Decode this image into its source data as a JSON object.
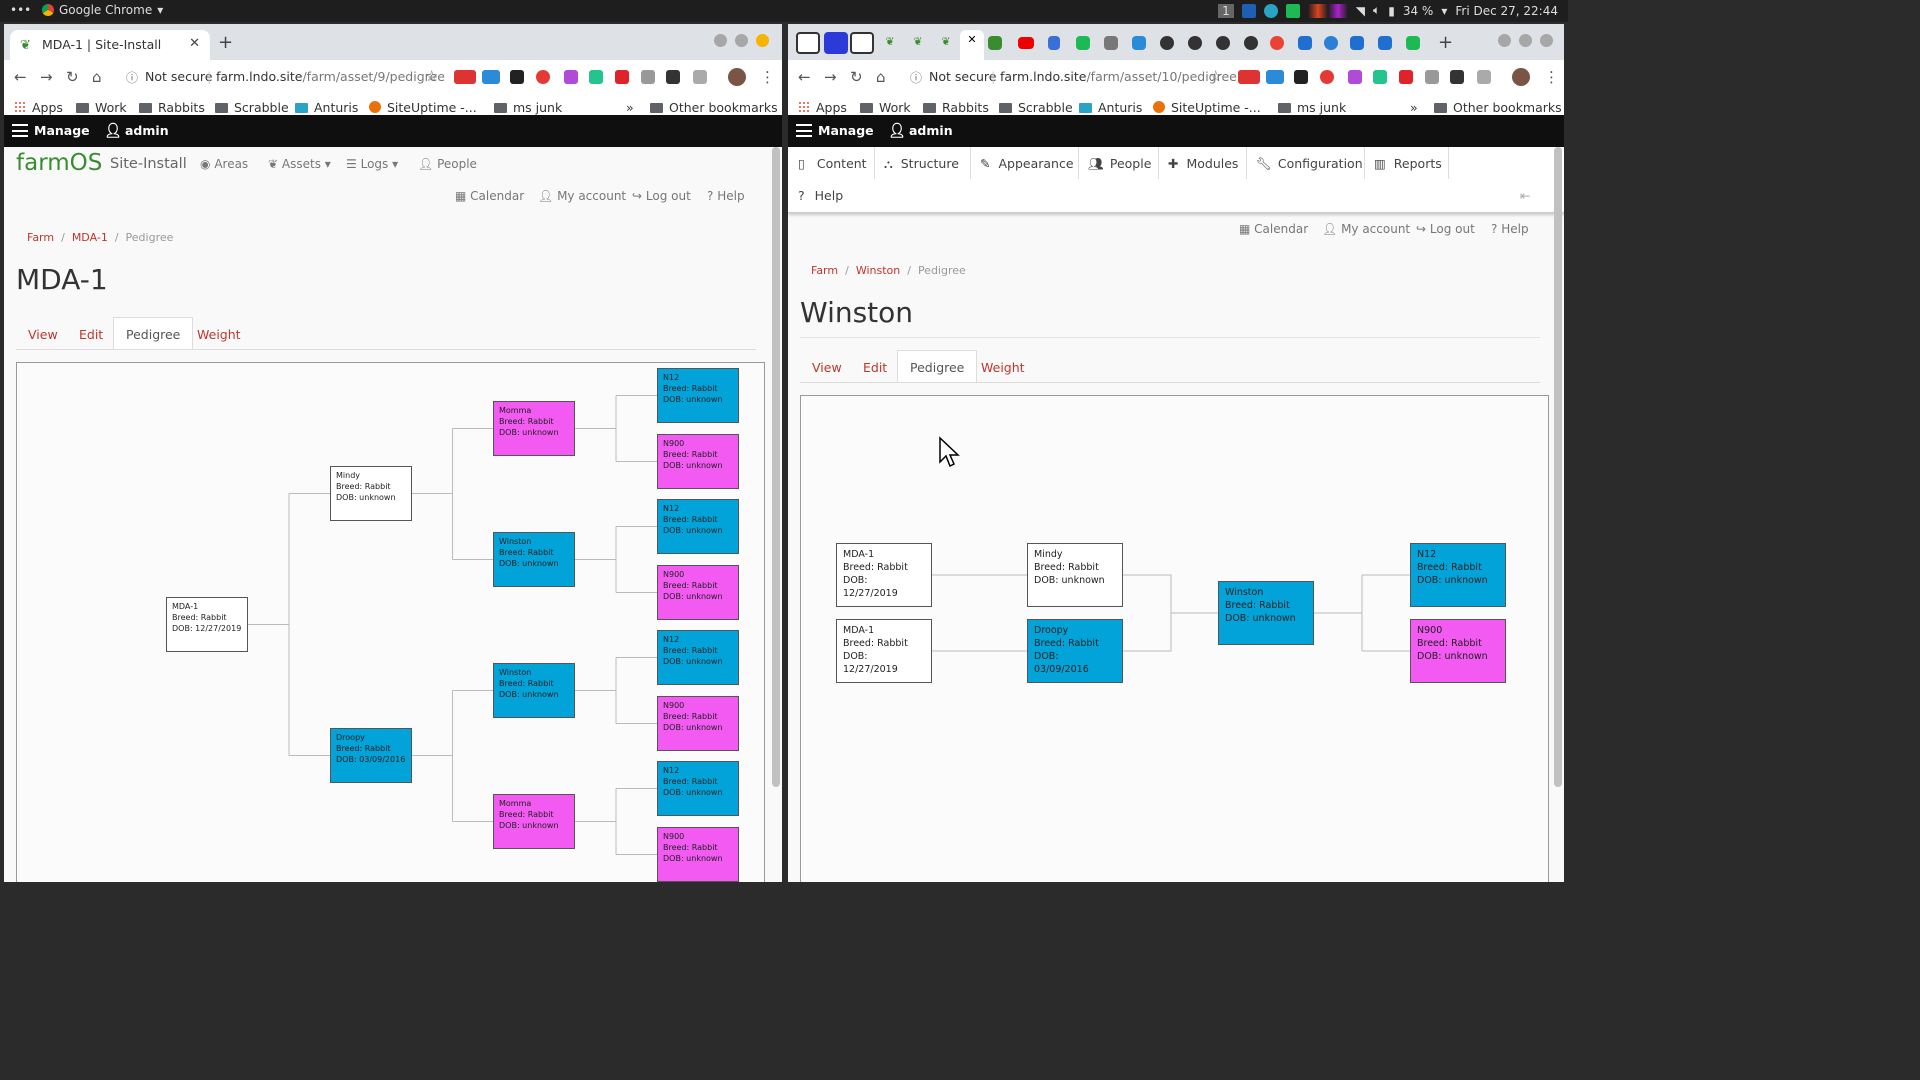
{
  "system_bar": {
    "menu_dots": "•••",
    "app_name": "Google Chrome",
    "workspace": "1",
    "battery": "34 %",
    "clock": "Fri Dec 27, 22:44"
  },
  "left_window": {
    "tab_title": "MDA-1 | Site-Install",
    "address": {
      "security": "Not secure",
      "host": "farm.lndo.site",
      "path": "/farm/asset/9/pedigree"
    },
    "toolbar": {
      "back": "←",
      "forward": "→",
      "reload": "↻",
      "home": "⌂",
      "star": "☆",
      "menu": "⋮"
    },
    "bookmarks": [
      "Apps",
      "Work",
      "Rabbits",
      "Scrabble",
      "Anturis",
      "SiteUptime -...",
      "ms junk"
    ],
    "bookmarks_more": "»",
    "other_bookmarks": "Other bookmarks",
    "admin_bar": {
      "manage": "Manage",
      "user": "admin"
    },
    "brand": "farmOS",
    "site_name": "Site-Install",
    "main_nav": [
      "Areas",
      "Assets",
      "Logs",
      "People"
    ],
    "secondary_nav": [
      "Calendar",
      "My account",
      "Log out",
      "Help"
    ],
    "breadcrumb": [
      "Farm",
      "MDA-1",
      "Pedigree"
    ],
    "page_title": "MDA-1",
    "tabs": [
      "View",
      "Edit",
      "Pedigree",
      "Weight"
    ],
    "pedigree": [
      {
        "name": "MDA-1",
        "breed": "Breed: Rabbit",
        "dob": "DOB: 12/27/2019",
        "color": "white"
      },
      {
        "name": "Mindy",
        "breed": "Breed: Rabbit",
        "dob": "DOB: unknown",
        "color": "white"
      },
      {
        "name": "Droopy",
        "breed": "Breed: Rabbit",
        "dob": "DOB: 03/09/2016",
        "color": "blue"
      },
      {
        "name": "Momma",
        "breed": "Breed: Rabbit",
        "dob": "DOB: unknown",
        "color": "pink"
      },
      {
        "name": "Winston",
        "breed": "Breed: Rabbit",
        "dob": "DOB: unknown",
        "color": "blue"
      },
      {
        "name": "Winston",
        "breed": "Breed: Rabbit",
        "dob": "DOB: unknown",
        "color": "blue"
      },
      {
        "name": "Momma",
        "breed": "Breed: Rabbit",
        "dob": "DOB: unknown",
        "color": "pink"
      },
      {
        "name": "N12",
        "breed": "Breed: Rabbit",
        "dob": "DOB: unknown",
        "color": "blue"
      },
      {
        "name": "N900",
        "breed": "Breed: Rabbit",
        "dob": "DOB: unknown",
        "color": "pink"
      },
      {
        "name": "N12",
        "breed": "Breed: Rabbit",
        "dob": "DOB: unknown",
        "color": "blue"
      },
      {
        "name": "N900",
        "breed": "Breed: Rabbit",
        "dob": "DOB: unknown",
        "color": "pink"
      },
      {
        "name": "N12",
        "breed": "Breed: Rabbit",
        "dob": "DOB: unknown",
        "color": "blue"
      },
      {
        "name": "N900",
        "breed": "Breed: Rabbit",
        "dob": "DOB: unknown",
        "color": "pink"
      },
      {
        "name": "N12",
        "breed": "Breed: Rabbit",
        "dob": "DOB: unknown",
        "color": "blue"
      },
      {
        "name": "N900",
        "breed": "Breed: Rabbit",
        "dob": "DOB: unknown",
        "color": "pink"
      }
    ]
  },
  "right_window": {
    "tab_close": "✕",
    "new_tab": "+",
    "address": {
      "security": "Not secure",
      "host": "farm.lndo.site",
      "path": "/farm/asset/10/pedigree"
    },
    "bookmarks": [
      "Apps",
      "Work",
      "Rabbits",
      "Scrabble",
      "Anturis",
      "SiteUptime -...",
      "ms junk"
    ],
    "bookmarks_more": "»",
    "other_bookmarks": "Other bookmarks",
    "admin_bar": {
      "manage": "Manage",
      "user": "admin"
    },
    "admin_menu": [
      "Content",
      "Structure",
      "Appearance",
      "People",
      "Modules",
      "Configuration",
      "Reports",
      "Help"
    ],
    "secondary_nav": [
      "Calendar",
      "My account",
      "Log out",
      "Help"
    ],
    "breadcrumb": [
      "Farm",
      "Winston",
      "Pedigree"
    ],
    "page_title": "Winston",
    "tabs": [
      "View",
      "Edit",
      "Pedigree",
      "Weight"
    ],
    "pedigree": [
      {
        "name": "MDA-1",
        "breed": "Breed: Rabbit",
        "dob": "DOB: 12/27/2019",
        "color": "white"
      },
      {
        "name": "MDA-1",
        "breed": "Breed: Rabbit",
        "dob": "DOB: 12/27/2019",
        "color": "white"
      },
      {
        "name": "Mindy",
        "breed": "Breed: Rabbit",
        "dob": "DOB: unknown",
        "color": "white"
      },
      {
        "name": "Droopy",
        "breed": "Breed: Rabbit",
        "dob": "DOB: 03/09/2016",
        "color": "blue"
      },
      {
        "name": "Winston",
        "breed": "Breed: Rabbit",
        "dob": "DOB: unknown",
        "color": "blue"
      },
      {
        "name": "N12",
        "breed": "Breed: Rabbit",
        "dob": "DOB: unknown",
        "color": "blue"
      },
      {
        "name": "N900",
        "breed": "Breed: Rabbit",
        "dob": "DOB: unknown",
        "color": "pink"
      }
    ]
  }
}
